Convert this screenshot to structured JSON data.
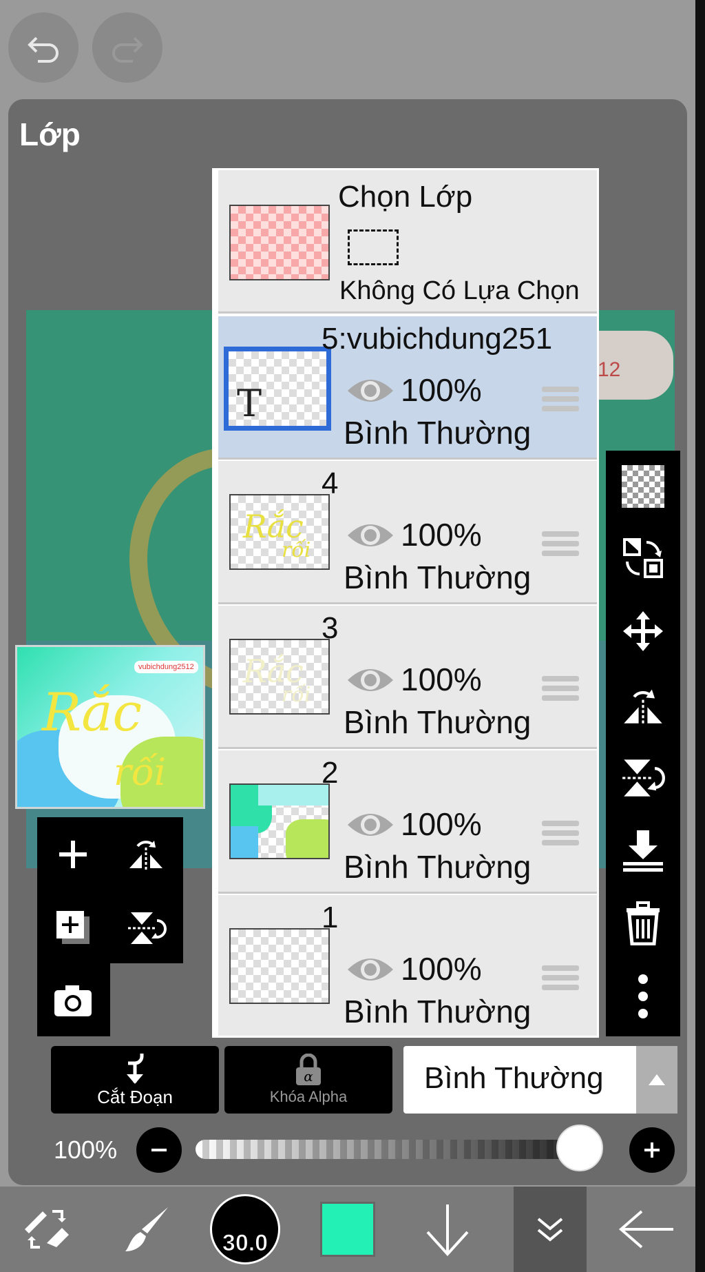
{
  "panel": {
    "title": "Lớp"
  },
  "selection_layer": {
    "title": "Chọn Lớp",
    "status": "Không Có Lựa Chọn"
  },
  "layers": [
    {
      "name": "5:vubichdung251",
      "opacity": "100%",
      "blend": "Bình Thường",
      "selected": true,
      "thumb_text": "T"
    },
    {
      "name": "4",
      "opacity": "100%",
      "blend": "Bình Thường",
      "selected": false
    },
    {
      "name": "3",
      "opacity": "100%",
      "blend": "Bình Thường",
      "selected": false
    },
    {
      "name": "2",
      "opacity": "100%",
      "blend": "Bình Thường",
      "selected": false
    },
    {
      "name": "1",
      "opacity": "100%",
      "blend": "Bình Thường",
      "selected": false
    }
  ],
  "canvas": {
    "watermark_fragment": "12"
  },
  "preview": {
    "watermark": "vubichdung2512",
    "art_line1": "Rắc",
    "art_line2": "rối"
  },
  "controls": {
    "clip_label": "Cắt Đoạn",
    "alpha_lock_label": "Khóa Alpha",
    "blend_mode": "Bình Thường",
    "opacity_label": "100%",
    "opacity_value": 1.0
  },
  "toolbar": {
    "brush_size": "30.0",
    "color": "#22f0b4"
  },
  "icons": [
    "undo-icon",
    "redo-icon",
    "checker-icon",
    "swap-icon",
    "move-icon",
    "flip-horizontal-icon",
    "flip-vertical-icon",
    "merge-down-icon",
    "trash-icon",
    "more-icon",
    "add-layer-icon",
    "add-copy-icon",
    "camera-icon",
    "clip-arrow-icon",
    "lock-icon",
    "minus-icon",
    "plus-icon",
    "transform-tool-icon",
    "brush-icon",
    "arrow-down-icon",
    "chevron-down-double-icon",
    "back-arrow-icon"
  ]
}
